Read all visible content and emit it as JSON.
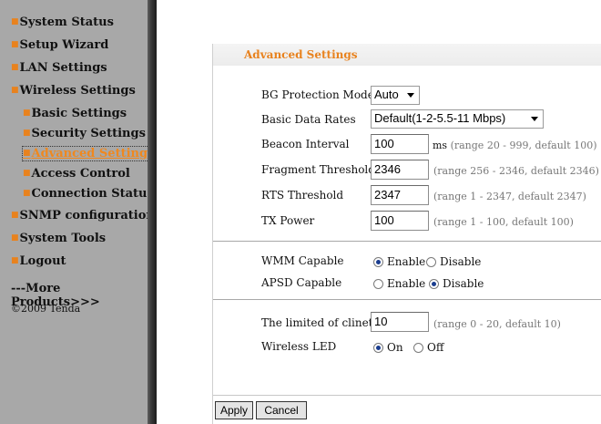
{
  "sidebar": {
    "items": [
      {
        "label": "System Status"
      },
      {
        "label": "Setup Wizard"
      },
      {
        "label": "LAN Settings"
      },
      {
        "label": "Wireless Settings"
      },
      {
        "label": "Basic Settings"
      },
      {
        "label": "Security Settings"
      },
      {
        "label": "Advanced Settings"
      },
      {
        "label": "Access Control"
      },
      {
        "label": "Connection Status"
      },
      {
        "label": "SNMP configuration"
      },
      {
        "label": "System Tools"
      },
      {
        "label": "Logout"
      }
    ],
    "more": "---More Products>>>",
    "copyright": "©2009 Tenda",
    "bullet": "■"
  },
  "panel": {
    "title": "Advanced Settings",
    "bg_protection": {
      "label": "BG Protection Mode",
      "value": "Auto"
    },
    "basic_rates": {
      "label": "Basic Data Rates",
      "value": "Default(1-2-5.5-11 Mbps)"
    },
    "beacon": {
      "label": "Beacon Interval",
      "value": "100",
      "unit": "ms",
      "hint": "(range 20 - 999, default 100)"
    },
    "fragment": {
      "label": "Fragment Threshold",
      "value": "2346",
      "hint": "(range 256 - 2346, default 2346)"
    },
    "rts": {
      "label": "RTS Threshold",
      "value": "2347",
      "hint": "(range 1 - 2347, default 2347)"
    },
    "tx_power": {
      "label": "TX Power",
      "value": "100",
      "hint": "(range 1 - 100, default 100)"
    },
    "wmm": {
      "label": "WMM Capable",
      "enable": "Enable",
      "disable": "Disable",
      "selected": "Enable"
    },
    "apsd": {
      "label": "APSD Capable",
      "enable": "Enable",
      "disable": "Disable",
      "selected": "Disable"
    },
    "client_limit": {
      "label": "The limited of clinet",
      "value": "10",
      "hint": "(range 0 - 20, default 10)"
    },
    "led": {
      "label": "Wireless LED",
      "on": "On",
      "off": "Off",
      "selected": "On"
    },
    "apply": "Apply",
    "cancel": "Cancel"
  },
  "colors": {
    "accent": "#e8821e",
    "sidebar_bg": "#a8a8a8",
    "radio_dot": "#1a3d8f"
  }
}
